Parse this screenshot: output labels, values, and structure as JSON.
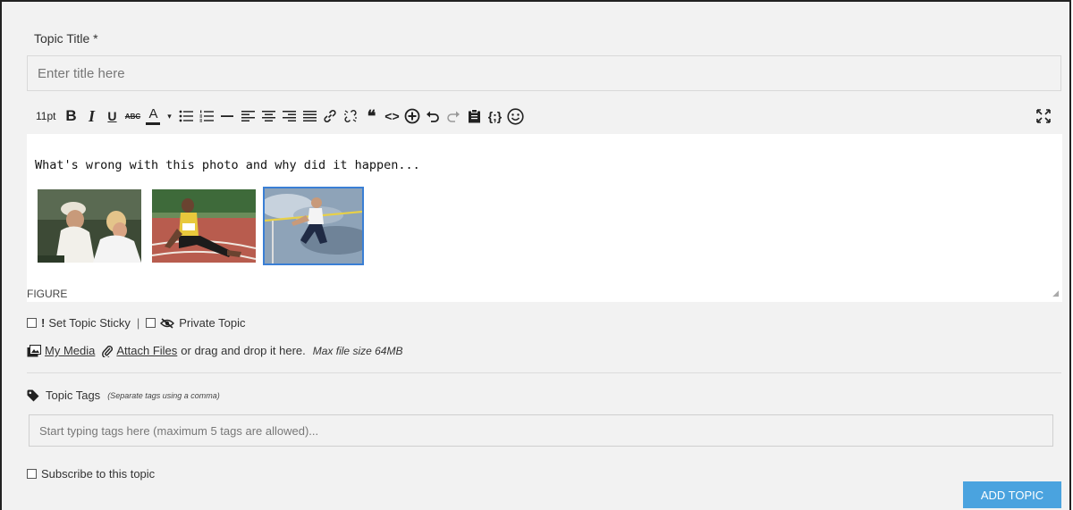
{
  "form": {
    "title_label": "Topic Title *",
    "title_placeholder": "Enter title here",
    "title_value": ""
  },
  "toolbar": {
    "font_size": "11pt",
    "bold": "B",
    "italic": "I",
    "underline": "U",
    "strikethrough": "ABC",
    "font_color": "A",
    "font_color_caret": "▾",
    "icons": [
      "bullet-list-icon",
      "numbered-list-icon",
      "horizontal-rule-icon",
      "align-left-icon",
      "align-center-icon",
      "align-right-icon",
      "justify-icon",
      "link-icon",
      "unlink-icon",
      "blockquote-icon",
      "code-icon",
      "insert-icon",
      "undo-icon",
      "redo-icon",
      "paste-icon",
      "code-sample-icon",
      "emoji-icon",
      "fullscreen-icon"
    ],
    "quote_glyph": "❝",
    "code_glyph": "<>",
    "sample_glyph": "{;}"
  },
  "editor": {
    "text": "What's wrong with this photo and why did it happen...",
    "images": [
      {
        "name": "coaches-photo"
      },
      {
        "name": "athlete-stretching-photo"
      },
      {
        "name": "high-jump-photo",
        "selected": true
      }
    ],
    "status_path": "FIGURE",
    "resize_glyph": "◢"
  },
  "options": {
    "sticky_label": "Set Topic Sticky",
    "separator": "|",
    "private_label": "Private Topic"
  },
  "attachments": {
    "my_media": "My Media",
    "attach_files": "Attach Files",
    "drag_text": "or drag and drop it here.",
    "max_size": "Max file size 64MB"
  },
  "tags": {
    "label": "Topic Tags",
    "hint": "(Separate tags using a comma)",
    "placeholder": "Start typing tags here (maximum 5 tags are allowed)..."
  },
  "subscribe": {
    "label": "Subscribe to this topic"
  },
  "submit": {
    "label": "ADD TOPIC"
  },
  "colors": {
    "accent": "#4aa3df",
    "selection": "#3a7fd5",
    "background": "#f2f2f2"
  }
}
